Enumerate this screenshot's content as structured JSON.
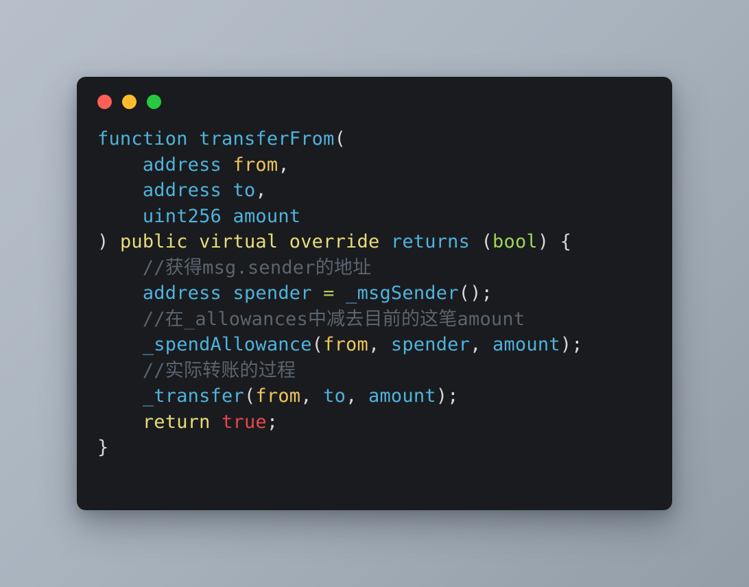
{
  "window": {
    "name": "code-snippet-window",
    "background_color": "#1a1b1e",
    "page_background_colors": [
      "#b7c0ca",
      "#939da8"
    ],
    "traffic_lights": [
      {
        "name": "close-button",
        "color": "#ff5f56"
      },
      {
        "name": "minimize-button",
        "color": "#ffbd2e"
      },
      {
        "name": "maximize-button",
        "color": "#27c93f"
      }
    ]
  },
  "colors": {
    "keyword": "#4eb3dd",
    "modifier": "#e8dd7a",
    "param": "#efc65c",
    "type": "#9dd65a",
    "operator": "#b5cc5a",
    "boolean": "#e5484d",
    "punctuation": "#d6d8da",
    "comment": "#5a6570"
  },
  "code": {
    "language": "solidity",
    "lines": [
      {
        "indent": 0,
        "tokens": [
          {
            "t": "function",
            "c": "kw"
          },
          {
            "t": " ",
            "c": "punct"
          },
          {
            "t": "transferFrom",
            "c": "ident"
          },
          {
            "t": "(",
            "c": "punct"
          }
        ]
      },
      {
        "indent": 1,
        "tokens": [
          {
            "t": "address",
            "c": "kw"
          },
          {
            "t": " ",
            "c": "punct"
          },
          {
            "t": "from",
            "c": "param"
          },
          {
            "t": ",",
            "c": "punct"
          }
        ]
      },
      {
        "indent": 1,
        "tokens": [
          {
            "t": "address",
            "c": "kw"
          },
          {
            "t": " ",
            "c": "punct"
          },
          {
            "t": "to",
            "c": "ident"
          },
          {
            "t": ",",
            "c": "punct"
          }
        ]
      },
      {
        "indent": 1,
        "tokens": [
          {
            "t": "uint256",
            "c": "kw"
          },
          {
            "t": " ",
            "c": "punct"
          },
          {
            "t": "amount",
            "c": "ident"
          }
        ]
      },
      {
        "indent": 0,
        "tokens": [
          {
            "t": ")",
            "c": "punct"
          },
          {
            "t": " ",
            "c": "punct"
          },
          {
            "t": "public virtual override",
            "c": "mod"
          },
          {
            "t": " ",
            "c": "punct"
          },
          {
            "t": "returns",
            "c": "kw"
          },
          {
            "t": " ",
            "c": "punct"
          },
          {
            "t": "(",
            "c": "punct"
          },
          {
            "t": "bool",
            "c": "type"
          },
          {
            "t": ")",
            "c": "punct"
          },
          {
            "t": " ",
            "c": "punct"
          },
          {
            "t": "{",
            "c": "punct"
          }
        ]
      },
      {
        "indent": 1,
        "tokens": [
          {
            "t": "//获得msg.sender的地址",
            "c": "comment"
          }
        ]
      },
      {
        "indent": 1,
        "tokens": [
          {
            "t": "address",
            "c": "kw"
          },
          {
            "t": " ",
            "c": "punct"
          },
          {
            "t": "spender",
            "c": "ident"
          },
          {
            "t": " ",
            "c": "punct"
          },
          {
            "t": "=",
            "c": "op"
          },
          {
            "t": " ",
            "c": "punct"
          },
          {
            "t": "_msgSender",
            "c": "ident"
          },
          {
            "t": "();",
            "c": "punct"
          }
        ]
      },
      {
        "indent": 1,
        "tokens": [
          {
            "t": "//在_allowances中减去目前的这笔amount",
            "c": "comment"
          }
        ]
      },
      {
        "indent": 1,
        "tokens": [
          {
            "t": "_spendAllowance",
            "c": "ident"
          },
          {
            "t": "(",
            "c": "punct"
          },
          {
            "t": "from",
            "c": "param"
          },
          {
            "t": ", ",
            "c": "punct"
          },
          {
            "t": "spender",
            "c": "ident"
          },
          {
            "t": ", ",
            "c": "punct"
          },
          {
            "t": "amount",
            "c": "ident"
          },
          {
            "t": ");",
            "c": "punct"
          }
        ]
      },
      {
        "indent": 1,
        "tokens": [
          {
            "t": "//实际转账的过程",
            "c": "comment"
          }
        ]
      },
      {
        "indent": 1,
        "tokens": [
          {
            "t": "_transfer",
            "c": "ident"
          },
          {
            "t": "(",
            "c": "punct"
          },
          {
            "t": "from",
            "c": "param"
          },
          {
            "t": ", ",
            "c": "punct"
          },
          {
            "t": "to",
            "c": "ident"
          },
          {
            "t": ", ",
            "c": "punct"
          },
          {
            "t": "amount",
            "c": "ident"
          },
          {
            "t": ");",
            "c": "punct"
          }
        ]
      },
      {
        "indent": 1,
        "tokens": [
          {
            "t": "return",
            "c": "mod"
          },
          {
            "t": " ",
            "c": "punct"
          },
          {
            "t": "true",
            "c": "bool"
          },
          {
            "t": ";",
            "c": "punct"
          }
        ]
      },
      {
        "indent": 0,
        "tokens": [
          {
            "t": "}",
            "c": "punct"
          }
        ]
      }
    ]
  }
}
